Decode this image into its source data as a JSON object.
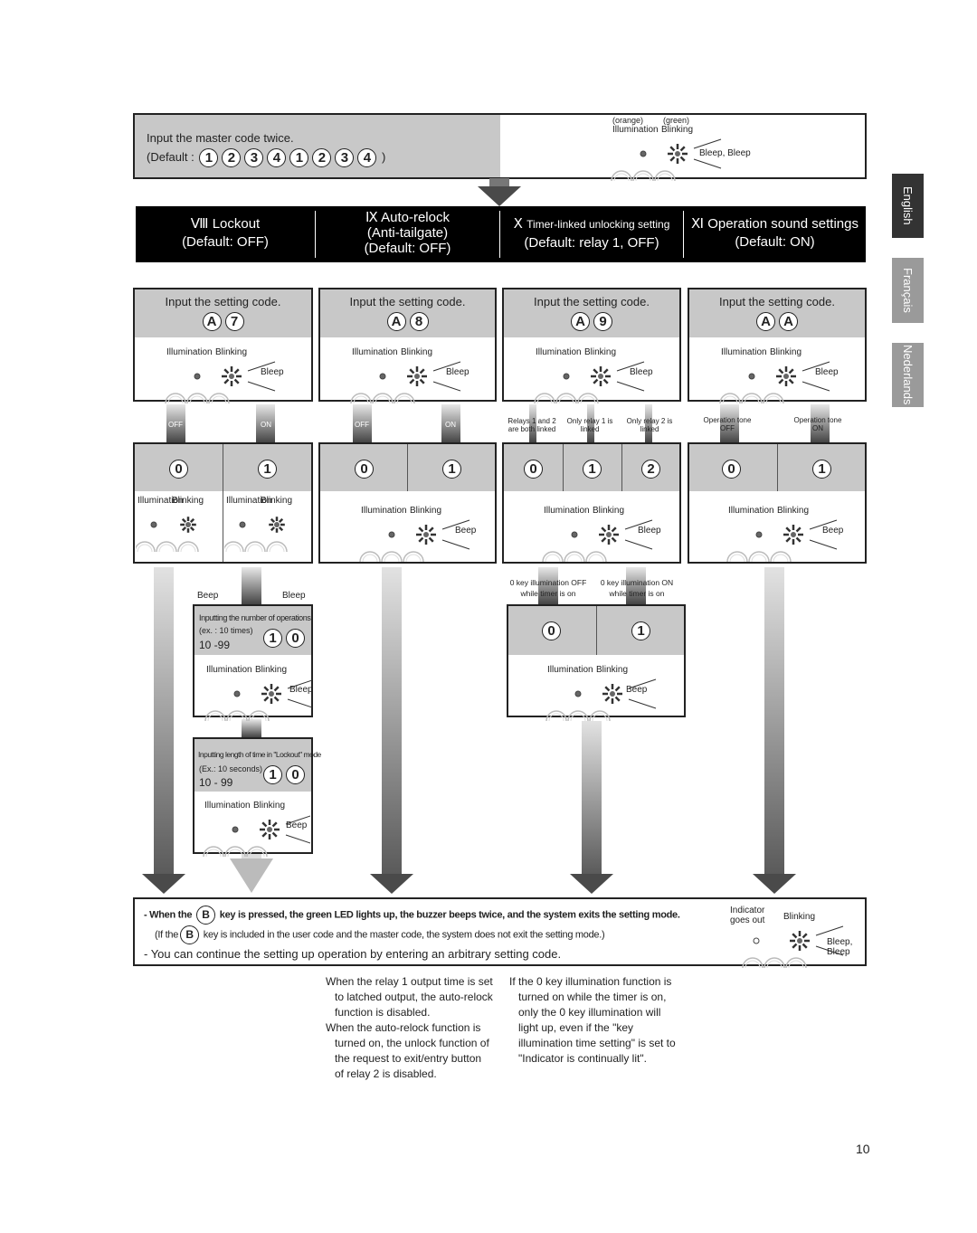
{
  "side_tabs": [
    "English",
    "Français",
    "Nederlands"
  ],
  "master": {
    "instruction": "Input the master code twice.",
    "default_prefix": "(Default :",
    "keys": [
      "1",
      "2",
      "3",
      "4",
      "1",
      "2",
      "3",
      "4"
    ],
    "suffix": ")",
    "illum_color": "(orange)",
    "blink_color": "(green)",
    "illumination": "Illumination",
    "blinking": "Blinking",
    "sound": "Bleep, Bleep"
  },
  "sections": [
    {
      "numeral": "Ⅷ",
      "title": "Lockout",
      "default": "(Default: OFF)"
    },
    {
      "numeral": "Ⅸ",
      "title": "Auto-relock",
      "subtitle": "(Anti-tailgate)",
      "default": "(Default: OFF)"
    },
    {
      "numeral": "Ⅹ",
      "title": "Timer-linked unlocking setting",
      "default": "(Default: relay 1, OFF)"
    },
    {
      "numeral": "Ⅺ",
      "title": "Operation sound settings",
      "default": "(Default: ON)"
    }
  ],
  "setting_boxes": [
    {
      "label": "Input the setting code.",
      "keys": [
        "A",
        "7"
      ],
      "illumination": "Illumination",
      "blinking": "Blinking",
      "sound": "Bleep"
    },
    {
      "label": "Input the setting code.",
      "keys": [
        "A",
        "8"
      ],
      "illumination": "Illumination",
      "blinking": "Blinking",
      "sound": "Bleep"
    },
    {
      "label": "Input the setting code.",
      "keys": [
        "A",
        "9"
      ],
      "illumination": "Illumination",
      "blinking": "Blinking",
      "sound": "Bleep"
    },
    {
      "label": "Input the setting code.",
      "keys": [
        "A",
        "A"
      ],
      "illumination": "Illumination",
      "blinking": "Blinking",
      "sound": "Bleep"
    }
  ],
  "option_labels": {
    "c1": [
      "OFF",
      "ON"
    ],
    "c2": [
      "OFF",
      "ON"
    ],
    "c3": [
      "Relays 1 and 2 are both linked",
      "Only relay 1 is linked",
      "Only relay 2 is linked"
    ],
    "c4": [
      "Operation tone OFF",
      "Operation tone ON"
    ]
  },
  "options": {
    "c1": {
      "keys": [
        "0",
        "1"
      ],
      "leds": [
        {
          "illumination": "Illumination",
          "blinking": "Blinking",
          "sound": "Beep"
        },
        {
          "illumination": "Illumination",
          "blinking": "Blinking",
          "sound": "Bleep"
        }
      ]
    },
    "c2": {
      "keys": [
        "0",
        "1"
      ],
      "led": {
        "illumination": "Illumination",
        "blinking": "Blinking",
        "sound": "Beep"
      }
    },
    "c3": {
      "keys": [
        "0",
        "1",
        "2"
      ],
      "led": {
        "illumination": "Illumination",
        "blinking": "Blinking",
        "sound": "Bleep"
      }
    },
    "c4": {
      "keys": [
        "0",
        "1"
      ],
      "led": {
        "illumination": "Illumination",
        "blinking": "Blinking",
        "sound": "Beep"
      }
    }
  },
  "lockout_count": {
    "label": "Inputting the number of operations",
    "example": "(ex. : 10 times)",
    "range": "10 -99",
    "keys": [
      "1",
      "0"
    ],
    "led": {
      "illumination": "Illumination",
      "blinking": "Blinking",
      "sound": "Bleep"
    }
  },
  "lockout_time": {
    "label": "Inputting length of time in \"Lockout\" mode",
    "example": "(Ex.: 10 seconds)",
    "range": "10 - 99",
    "keys": [
      "1",
      "0"
    ],
    "led": {
      "illumination": "Illumination",
      "blinking": "Blinking",
      "sound": "Beep"
    }
  },
  "timer_key": {
    "labels": [
      "0 key illumination OFF while timer is on",
      "0 key illumination ON while timer is on"
    ],
    "keys": [
      "0",
      "1"
    ],
    "led": {
      "illumination": "Illumination",
      "blinking": "Blinking",
      "sound": "Beep"
    }
  },
  "exit": {
    "line1_pre": "- When the",
    "key": "B",
    "line1_post": "key is pressed, the green LED lights up, the buzzer beeps twice, and the system exits the setting mode.",
    "line2_pre": "(If the",
    "line2_post": "key is included in the user code and the master code, the system does not exit the setting mode.)",
    "line3": "- You can continue the setting up operation by entering an arbitrary setting code.",
    "indicator": "Indicator goes out",
    "blinking": "Blinking",
    "sound": "Bleep, Bleep"
  },
  "notes": {
    "col1": [
      "When the relay 1 output time is set to latched output, the auto-relock function is disabled.",
      "When the auto-relock function is turned on, the unlock function of the request to exit/entry button of relay 2 is disabled."
    ],
    "col2": [
      "If the 0 key illumination function is turned on while the timer is on, only the 0 key illumination will light up, even if the \"key illumination time setting\" is set to \"Indicator is continually lit\"."
    ]
  },
  "page_number": "10"
}
